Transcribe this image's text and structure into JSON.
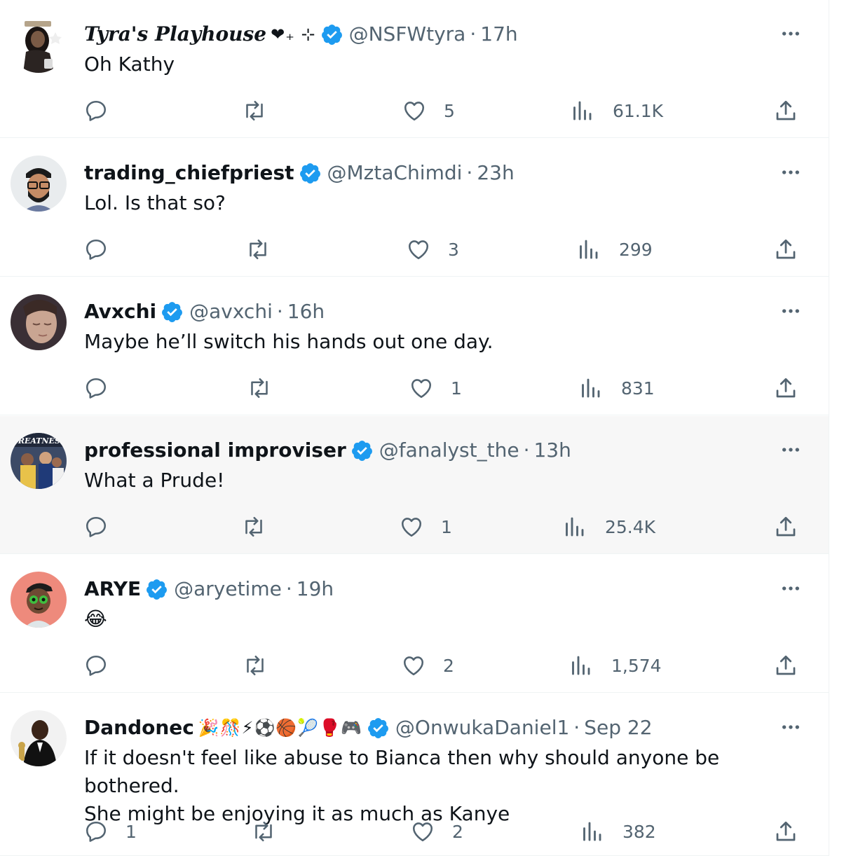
{
  "tweets": [
    {
      "name": "Tyra's Playhouse",
      "name_decoration": "❤₊ ⊹",
      "handle": "@NSFWtyra",
      "time": "17h",
      "text": "Oh Kathy",
      "replies": "",
      "retweets": "",
      "likes": "5",
      "views": "61.1K"
    },
    {
      "name": "trading_chiefpriest",
      "handle": "@MztaChimdi",
      "time": "23h",
      "text": "Lol. Is that so?",
      "replies": "",
      "retweets": "",
      "likes": "3",
      "views": "299"
    },
    {
      "name": "Avxchi",
      "handle": "@avxchi",
      "time": "16h",
      "text": "Maybe he’ll switch his hands out one day.",
      "replies": "",
      "retweets": "",
      "likes": "1",
      "views": "831"
    },
    {
      "name": "professional improviser",
      "handle": "@fanalyst_the",
      "time": "13h",
      "text": "What a Prude!",
      "replies": "",
      "retweets": "",
      "likes": "1",
      "views": "25.4K",
      "avatar_text": "GREATNESS"
    },
    {
      "name": "ARYE",
      "handle": "@aryetime",
      "time": "19h",
      "text": "😂",
      "replies": "",
      "retweets": "",
      "likes": "2",
      "views": "1,574"
    },
    {
      "name": "Dandonec",
      "name_decoration": "🎉🎊⚡⚽🏀🎾🥊🎮",
      "handle": "@OnwukaDaniel1",
      "time": "Sep 22",
      "text": "If it doesn't feel like abuse to Bianca then why should anyone be bothered.\nShe might be enjoying it as much as Kanye",
      "replies": "1",
      "retweets": "",
      "likes": "2",
      "views": "382"
    }
  ],
  "meta_separator": "·",
  "colors": {
    "text": "#0f1419",
    "secondary": "#536471",
    "verified": "#1d9bf0",
    "divider": "#eff3f4",
    "highlight_bg": "#f7f7f7"
  },
  "icons": [
    "reply-icon",
    "retweet-icon",
    "like-icon",
    "views-icon",
    "share-icon",
    "more-icon",
    "verified-badge-icon"
  ]
}
